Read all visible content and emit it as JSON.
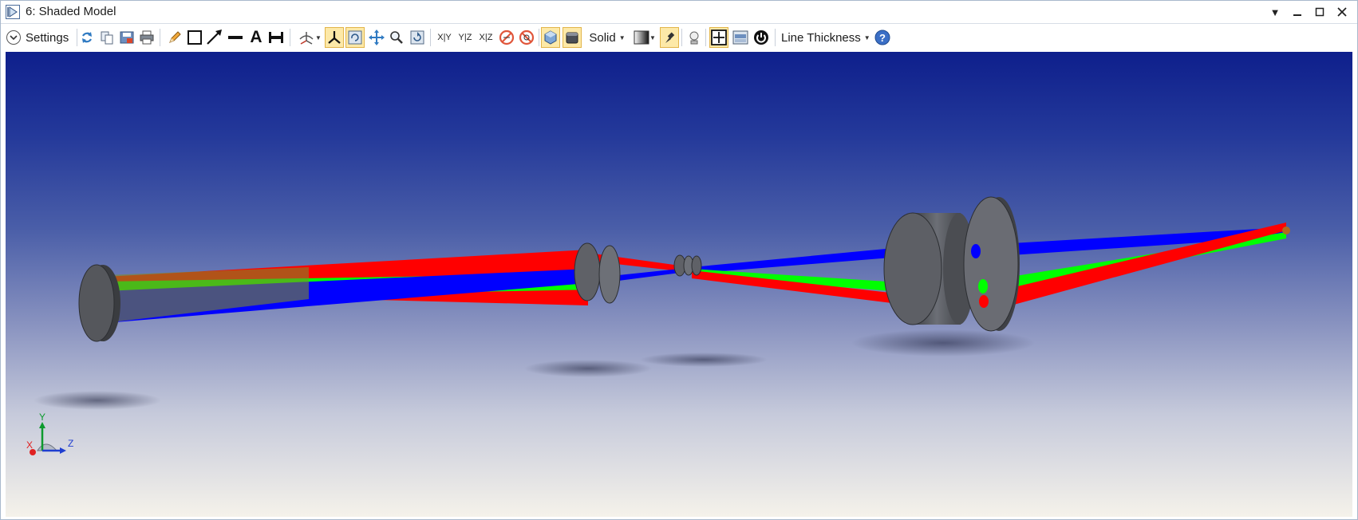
{
  "window": {
    "title": "6: Shaded Model"
  },
  "toolbar": {
    "settings_label": "Settings",
    "solid_label": "Solid",
    "line_thickness_label": "Line Thickness",
    "xy_label": "X|Y",
    "yz_label": "Y|Z",
    "xz_label": "X|Z",
    "text_tool_label": "A"
  },
  "viewport": {
    "axis_y_label": "Y",
    "axis_x_label": "X",
    "axis_z_label": "Z"
  },
  "colors": {
    "accent_active": "#fde9a8",
    "ray_red": "#ff0000",
    "ray_green": "#00ff00",
    "ray_blue": "#0000ff",
    "element_gray": "#55575c"
  }
}
